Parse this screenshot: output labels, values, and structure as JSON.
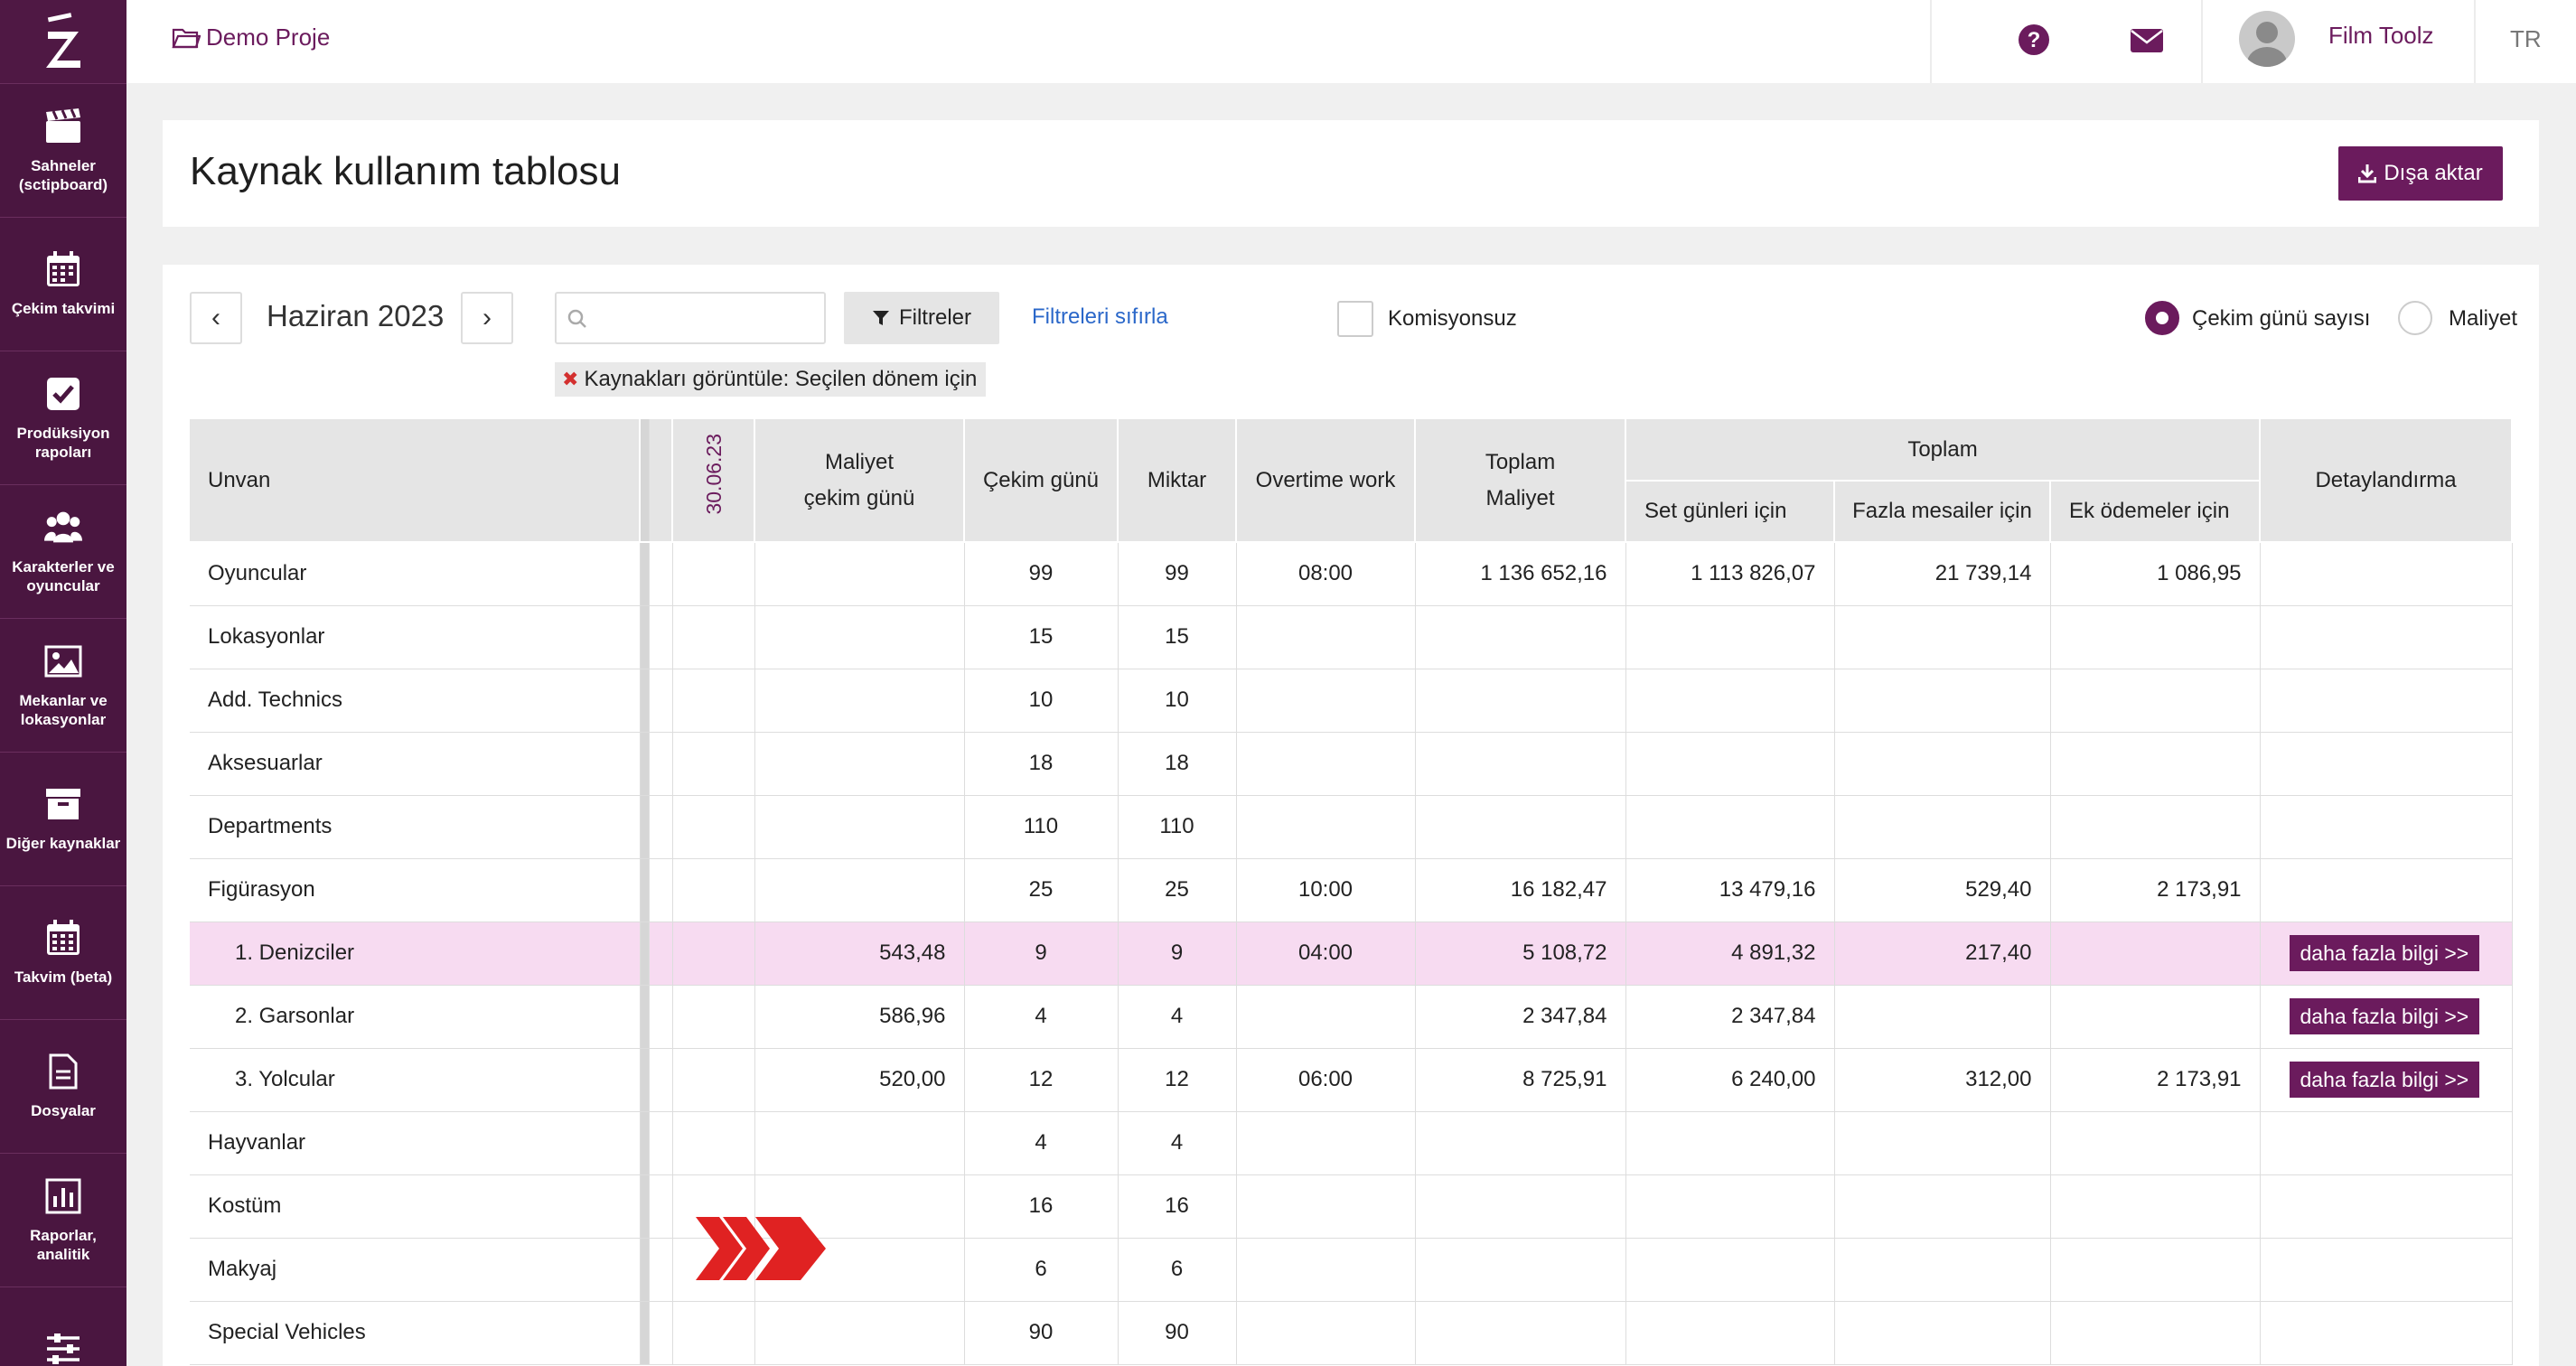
{
  "sidebar": {
    "logo": "Z",
    "items": [
      {
        "label": "Sahneler (sctipboard)",
        "icon": "clapperboard-icon"
      },
      {
        "label": "Çekim takvimi",
        "icon": "calendar-icon"
      },
      {
        "label": "Prodüksiyon rapoları",
        "icon": "checkbox-icon"
      },
      {
        "label": "Karakterler ve oyuncular",
        "icon": "people-icon"
      },
      {
        "label": "Mekanlar ve lokasyonlar",
        "icon": "image-icon"
      },
      {
        "label": "Diğer kaynaklar",
        "icon": "archive-icon"
      },
      {
        "label": "Takvim (beta)",
        "icon": "calendar-grid-icon"
      },
      {
        "label": "Dosyalar",
        "icon": "document-icon"
      },
      {
        "label": "Raporlar, analitik",
        "icon": "bar-chart-icon"
      },
      {
        "label": "",
        "icon": "sliders-icon"
      }
    ]
  },
  "topbar": {
    "project": "Demo Proje",
    "user": "Film Toolz",
    "lang": "TR"
  },
  "header": {
    "title": "Kaynak kullanım tablosu",
    "export_label": "Dışa aktar"
  },
  "toolbar": {
    "prev": "‹",
    "next": "›",
    "month": "Haziran 2023",
    "search_value": "",
    "filter_label": "Filtreler",
    "reset_label": "Filtreleri sıfırla",
    "chip_label": "Kaynakları görüntüle:",
    "chip_value": "Seçilen dönem için",
    "komisyon_label": "Komisyonsuz",
    "radio_days_label": "Çekim günü sayısı",
    "radio_cost_label": "Maliyet",
    "selected_mode": "Çekim günü sayısı"
  },
  "table": {
    "headers": {
      "unvan": "Unvan",
      "date": "30.06.23",
      "cost_day": "Maliyet çekim günü",
      "days": "Çekim günü",
      "qty": "Miktar",
      "overtime": "Overtime work",
      "total_cost": "Toplam Maliyet",
      "total_group": "Toplam",
      "set_days": "Set günleri için",
      "extra_hours": "Fazla mesailer için",
      "extra_pay": "Ek ödemeler için",
      "detail": "Detaylandırma"
    },
    "more_label": "daha fazla bilgi >>",
    "rows": [
      {
        "name": "Oyuncular",
        "sub": false,
        "cost_day": "",
        "days": "99",
        "qty": "99",
        "overtime": "08:00",
        "total": "1 136 652,16",
        "set": "1 113 826,07",
        "extra_h": "21 739,14",
        "extra_p": "1 086,95",
        "detail": false,
        "hl": false
      },
      {
        "name": "Lokasyonlar",
        "sub": false,
        "cost_day": "",
        "days": "15",
        "qty": "15",
        "overtime": "",
        "total": "",
        "set": "",
        "extra_h": "",
        "extra_p": "",
        "detail": false,
        "hl": false
      },
      {
        "name": "Add. Technics",
        "sub": false,
        "cost_day": "",
        "days": "10",
        "qty": "10",
        "overtime": "",
        "total": "",
        "set": "",
        "extra_h": "",
        "extra_p": "",
        "detail": false,
        "hl": false
      },
      {
        "name": "Aksesuarlar",
        "sub": false,
        "cost_day": "",
        "days": "18",
        "qty": "18",
        "overtime": "",
        "total": "",
        "set": "",
        "extra_h": "",
        "extra_p": "",
        "detail": false,
        "hl": false
      },
      {
        "name": "Departments",
        "sub": false,
        "cost_day": "",
        "days": "110",
        "qty": "110",
        "overtime": "",
        "total": "",
        "set": "",
        "extra_h": "",
        "extra_p": "",
        "detail": false,
        "hl": false
      },
      {
        "name": "Figürasyon",
        "sub": false,
        "cost_day": "",
        "days": "25",
        "qty": "25",
        "overtime": "10:00",
        "total": "16 182,47",
        "set": "13 479,16",
        "extra_h": "529,40",
        "extra_p": "2 173,91",
        "detail": false,
        "hl": false
      },
      {
        "name": "1. Denizciler",
        "sub": true,
        "cost_day": "543,48",
        "days": "9",
        "qty": "9",
        "overtime": "04:00",
        "total": "5 108,72",
        "set": "4 891,32",
        "extra_h": "217,40",
        "extra_p": "",
        "detail": true,
        "hl": true
      },
      {
        "name": "2. Garsonlar",
        "sub": true,
        "cost_day": "586,96",
        "days": "4",
        "qty": "4",
        "overtime": "",
        "total": "2 347,84",
        "set": "2 347,84",
        "extra_h": "",
        "extra_p": "",
        "detail": true,
        "hl": false
      },
      {
        "name": "3. Yolcular",
        "sub": true,
        "cost_day": "520,00",
        "days": "12",
        "qty": "12",
        "overtime": "06:00",
        "total": "8 725,91",
        "set": "6 240,00",
        "extra_h": "312,00",
        "extra_p": "2 173,91",
        "detail": true,
        "hl": false
      },
      {
        "name": "Hayvanlar",
        "sub": false,
        "cost_day": "",
        "days": "4",
        "qty": "4",
        "overtime": "",
        "total": "",
        "set": "",
        "extra_h": "",
        "extra_p": "",
        "detail": false,
        "hl": false
      },
      {
        "name": "Kostüm",
        "sub": false,
        "cost_day": "",
        "days": "16",
        "qty": "16",
        "overtime": "",
        "total": "",
        "set": "",
        "extra_h": "",
        "extra_p": "",
        "detail": false,
        "hl": false
      },
      {
        "name": "Makyaj",
        "sub": false,
        "cost_day": "",
        "days": "6",
        "qty": "6",
        "overtime": "",
        "total": "",
        "set": "",
        "extra_h": "",
        "extra_p": "",
        "detail": false,
        "hl": false
      },
      {
        "name": "Special Vehicles",
        "sub": false,
        "cost_day": "",
        "days": "90",
        "qty": "90",
        "overtime": "",
        "total": "",
        "set": "",
        "extra_h": "",
        "extra_p": "",
        "detail": false,
        "hl": false
      }
    ]
  },
  "colors": {
    "brand": "#6b1b5d",
    "sidebar": "#4a1640",
    "highlight_row": "#f7dbf1",
    "arrow": "#e02222",
    "link": "#2a67c9"
  }
}
